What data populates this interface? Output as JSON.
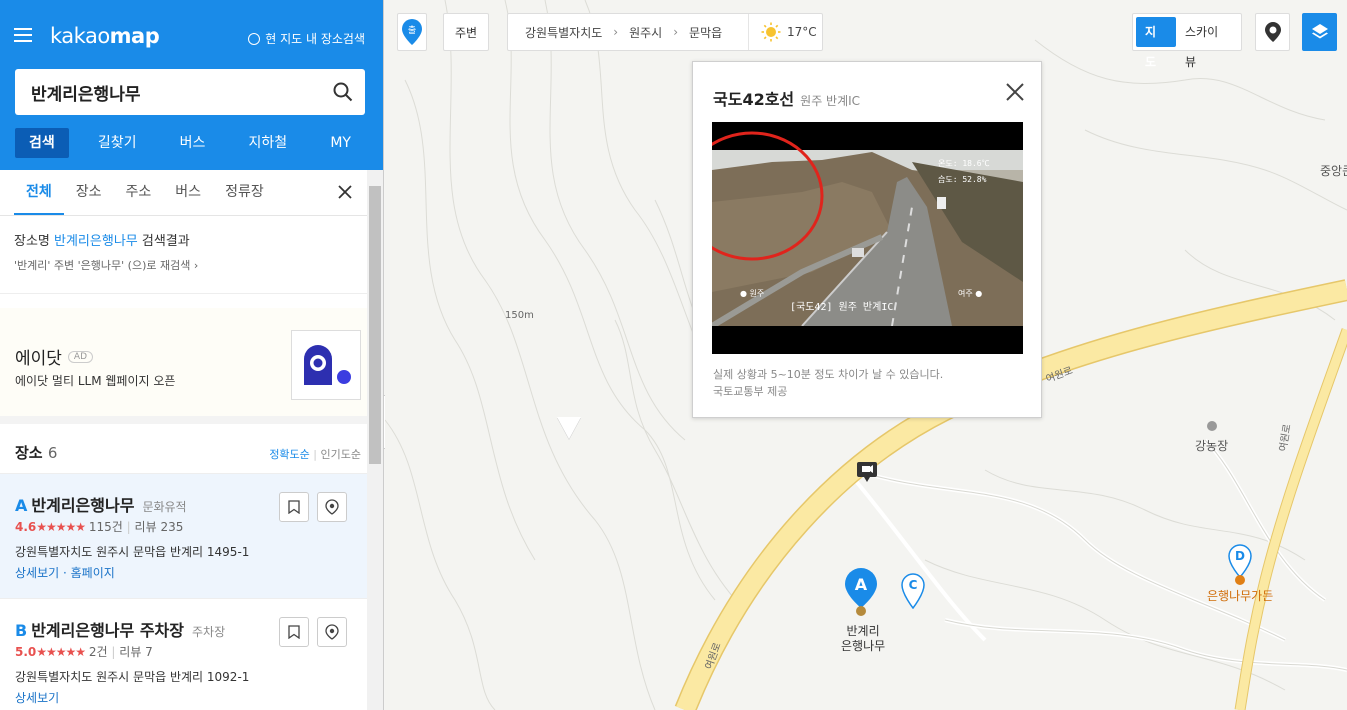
{
  "app": {
    "logo_prefix": "kakao",
    "logo_bold": "map",
    "map_search_toggle": "현 지도 내 장소검색"
  },
  "search": {
    "value": "반계리은행나무"
  },
  "main_tabs": [
    "검색",
    "길찾기",
    "버스",
    "지하철",
    "MY"
  ],
  "sub_tabs": [
    "전체",
    "장소",
    "주소",
    "버스",
    "정류장"
  ],
  "summary": {
    "prefix": "장소명 ",
    "keyword": "반계리은행나무",
    "suffix": " 검색결과",
    "research": "'반계리' 주변 '은행나무' (으)로 재검색"
  },
  "ad": {
    "title": "에이닷",
    "badge": "AD",
    "desc": "에이닷 멀티 LLM 웹페이지 오픈"
  },
  "places_header": {
    "title": "장소",
    "count": "6",
    "sort_accuracy": "정확도순",
    "sort_popular": "인기도순"
  },
  "places": [
    {
      "letter": "A",
      "name": "반계리은행나무",
      "category": "문화유적",
      "score": "4.6",
      "stars": "★★★★★",
      "count": "115건",
      "reviews": "리뷰 235",
      "address": "강원특별자치도 원주시 문막읍 반계리 1495-1",
      "link1": "상세보기",
      "link2": "홈페이지"
    },
    {
      "letter": "B",
      "name": "반계리은행나무 주차장",
      "category": "주차장",
      "score": "5.0",
      "stars": "★★★★★",
      "count": "2건",
      "reviews": "리뷰 7",
      "address": "강원특별자치도 원주시 문막읍 반계리 1092-1",
      "link1": "상세보기"
    }
  ],
  "topbar": {
    "start_pin": "출",
    "around": "주변",
    "crumbs": [
      "강원특별자치도",
      "원주시",
      "문막읍"
    ],
    "temperature": "17°C",
    "map_types": [
      "지도",
      "스카이뷰"
    ]
  },
  "cctv": {
    "title": "국도42호선",
    "subtitle": "원주 반계IC",
    "temp_overlay": "온도: 18.6℃",
    "humidity_overlay": "습도: 52.8%",
    "caption_left": "● 원주",
    "caption_center": "[국도42] 원주 반계IC",
    "caption_right": "여주 ●",
    "note1": "실제 상황과 5~10분 정도 차이가 날 수 있습니다.",
    "note2": "국토교통부 제공"
  },
  "map_labels": {
    "elevation": "150m",
    "road1": "여원로",
    "road2": "여원로",
    "road3": "여원로",
    "village": "강농장",
    "right_edge": "중앙큰",
    "marker_a_line1": "반계리",
    "marker_a_line2": "은행나무",
    "marker_d_label": "은행나무가든",
    "marker_a": "A",
    "marker_c": "C",
    "marker_d": "D"
  },
  "colors": {
    "brand_blue": "#1a8be8",
    "rating_red": "#e8514f",
    "road_yellow": "#fbe9a3",
    "road_outline": "#e6c76a"
  }
}
